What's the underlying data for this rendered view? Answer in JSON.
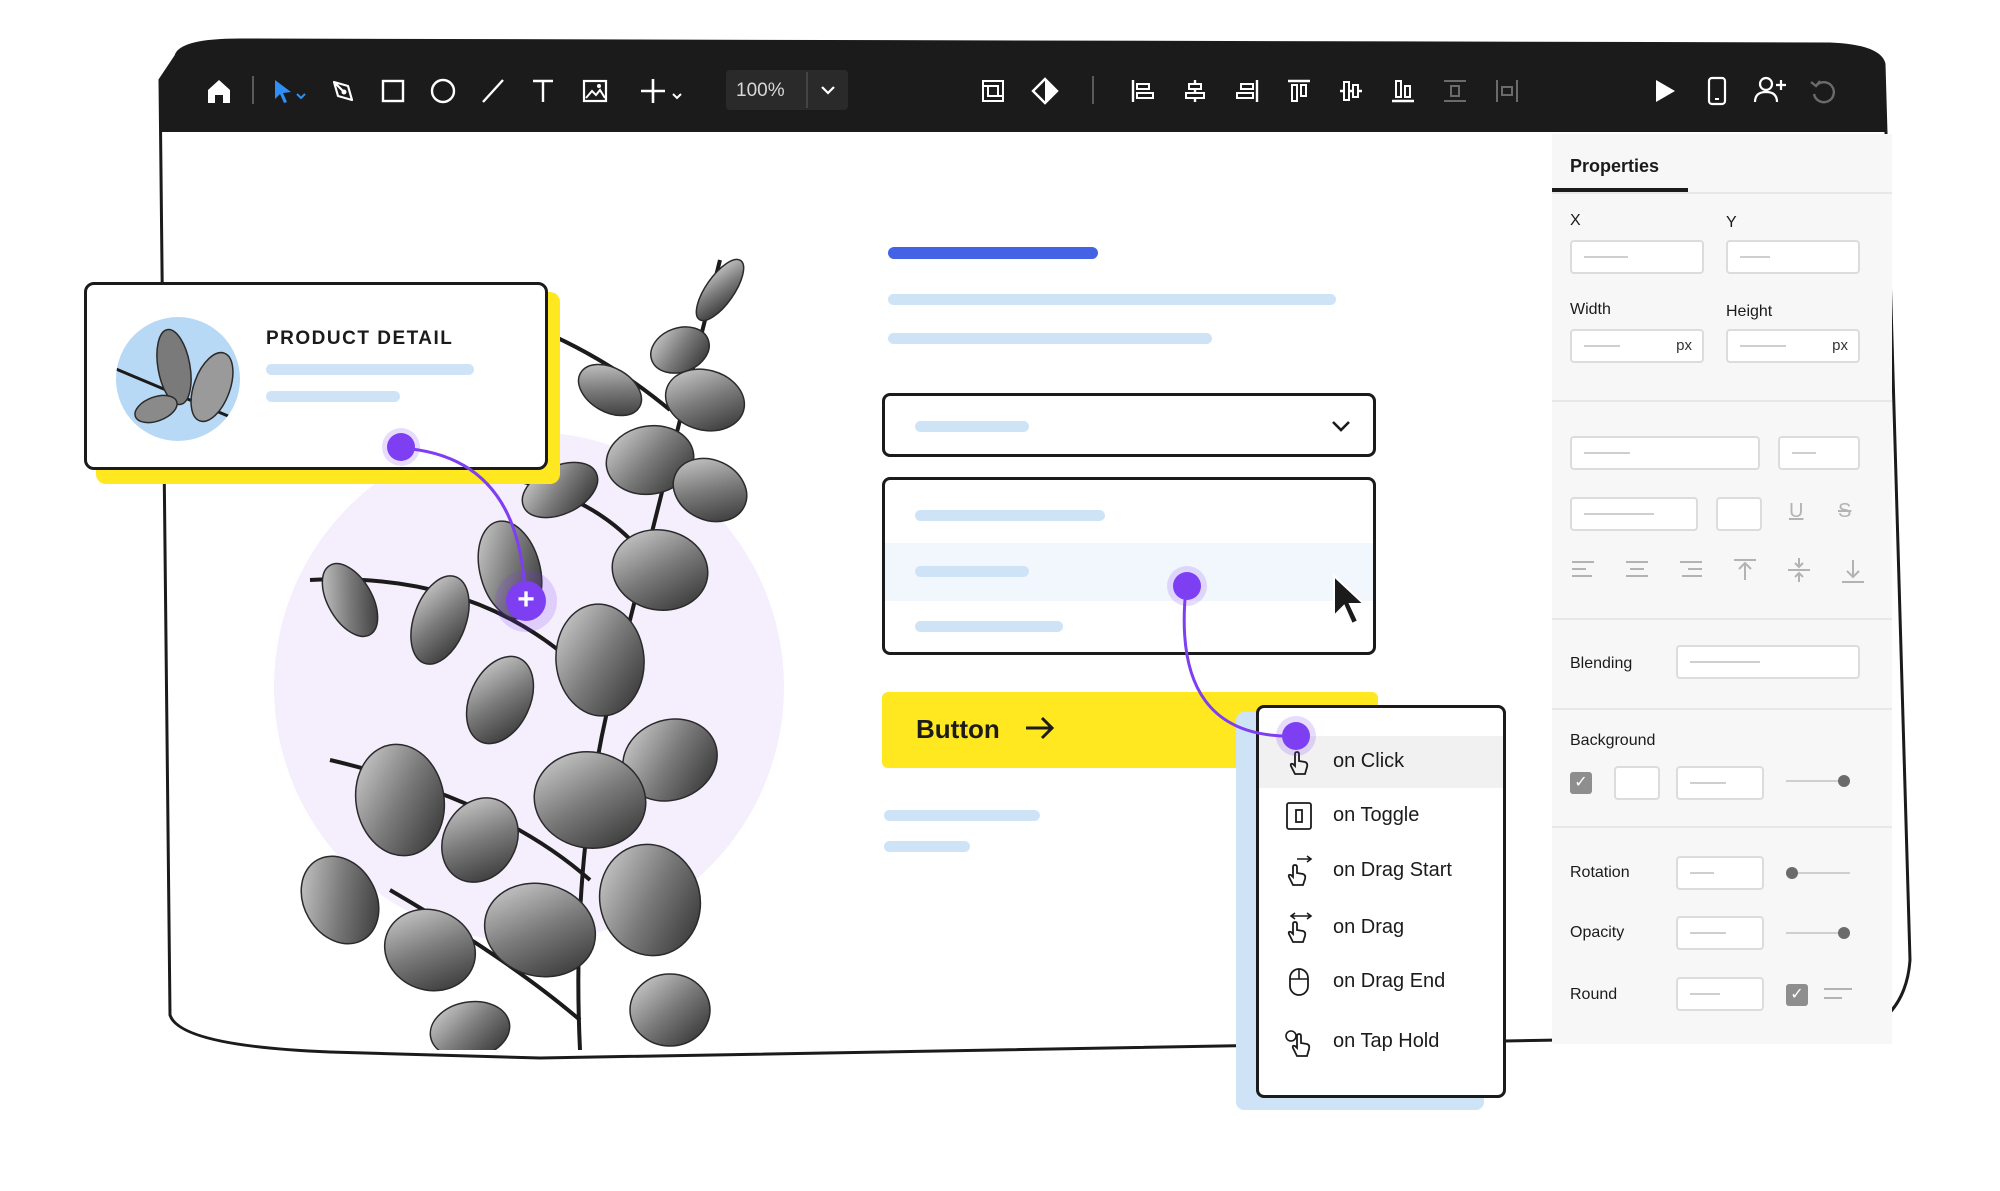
{
  "toolbar": {
    "zoom": "100%",
    "icons": [
      "home-icon",
      "pointer-icon",
      "pen-icon",
      "rectangle-icon",
      "ellipse-icon",
      "line-icon",
      "text-icon",
      "image-icon",
      "add-icon",
      "frame-icon",
      "component-icon",
      "align-left-icon",
      "align-center-h-icon",
      "align-right-icon",
      "align-top-icon",
      "align-middle-icon",
      "align-bottom-icon",
      "distribute-v-icon",
      "distribute-h-icon",
      "play-icon",
      "mobile-preview-icon",
      "add-user-icon",
      "undo-icon"
    ]
  },
  "properties": {
    "tab": "Properties",
    "x_label": "X",
    "y_label": "Y",
    "width_label": "Width",
    "height_label": "Height",
    "unit": "px",
    "blending_label": "Blending",
    "background_label": "Background",
    "rotation_label": "Rotation",
    "opacity_label": "Opacity",
    "round_label": "Round",
    "rotation_level": 0.1,
    "opacity_level": 0.9,
    "background_level": 0.9,
    "check_mark": "✓",
    "underline_glyph": "U",
    "strike_glyph": "S"
  },
  "canvas": {
    "button_label": "Button",
    "card_title": "PRODUCT DETAIL",
    "plus": "+"
  },
  "events_menu": {
    "items": [
      {
        "label": "on Click",
        "icon": "hand-pointer-icon",
        "active": true
      },
      {
        "label": "on Toggle",
        "icon": "toggle-icon",
        "active": false
      },
      {
        "label": "on Drag Start",
        "icon": "drag-start-icon",
        "active": false
      },
      {
        "label": "on Drag",
        "icon": "drag-icon",
        "active": false
      },
      {
        "label": "on Drag End",
        "icon": "mouse-icon",
        "active": false
      },
      {
        "label": "on Tap Hold",
        "icon": "tap-hold-icon",
        "active": false
      }
    ]
  },
  "colors": {
    "toolbar_bg": "#1b1b1b",
    "accent_purple": "#7e3ff2",
    "accent_yellow": "#ffe81f",
    "accent_blue": "#4362e6",
    "placeholder_blue": "#cfe3f7"
  }
}
